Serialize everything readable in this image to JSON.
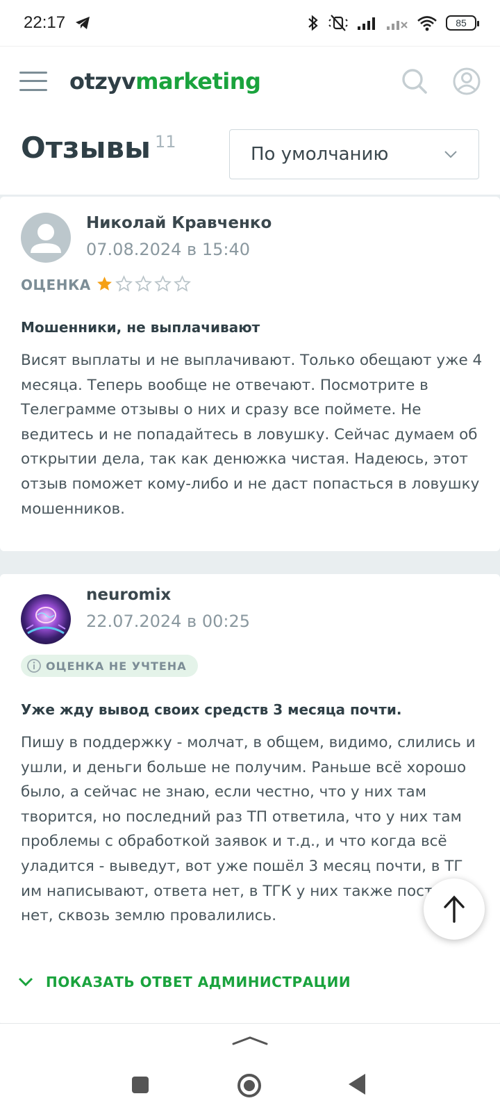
{
  "status_bar": {
    "time": "22:17",
    "battery": "85"
  },
  "header": {
    "logo_part1": "otzyv",
    "logo_part2": "marketing"
  },
  "reviews_header": {
    "title": "Отзывы",
    "count": "11",
    "sort_selected": "По умолчанию"
  },
  "reviews": [
    {
      "author": "Николай Кравченко",
      "date": "07.08.2024 в 15:40",
      "rating_label": "ОЦЕНКА",
      "rating": 1,
      "rating_max": 5,
      "title": "Мошенники, не выплачивают",
      "text": "Висят выплаты и не выплачивают. Только обещают уже 4 месяца. Теперь вообще не отвечают. Посмотрите в Телеграмме отзывы о них и сразу все поймете. Не ведитесь и не попадайтесь в ловушку. Сейчас думаем об открытии дела, так как денюжка чистая. Надеюсь, этот отзыв поможет кому-либо и не даст попасться в ловушку мошенников."
    },
    {
      "author": "neuromix",
      "date": "22.07.2024 в 00:25",
      "badge": "ОЦЕНКА НЕ УЧТЕНА",
      "title": "Уже жду вывод своих средств 3 месяца почти.",
      "text": "Пишу в поддержку - молчат, в общем, видимо, слились и ушли, и деньги больше не получим. Раньше всё хорошо было, а сейчас не знаю, если честно, что у них там творится, но последний раз ТП ответила, что у них там проблемы с обработкой заявок и т.д., и что когда всё уладится - выведут, вот уже пошёл 3 месяц почти, в ТГ им написывают, ответа нет, в ТГК у них также постов нет, сквозь землю провалились.",
      "admin_toggle": "ПОКАЗАТЬ ОТВЕТ АДМИНИСТРАЦИИ"
    }
  ],
  "colors": {
    "brand_green": "#1aa33d",
    "star_filled": "#f5a014",
    "star_empty": "#b8c3c8"
  }
}
